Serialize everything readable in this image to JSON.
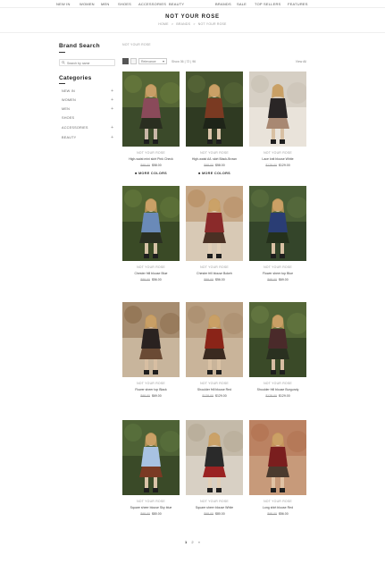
{
  "topnav": {
    "items": [
      "NEW IN",
      "WOMEN",
      "MEN",
      "SHOES",
      "ACCESSORIES",
      "BEAUTY",
      "BRANDS",
      "SALE",
      "TOP SELLERS",
      "FEATURES"
    ]
  },
  "header": {
    "title": "NOT YOUR ROSE",
    "breadcrumb": [
      "HOME",
      "BRANDS",
      "NOT YOUR ROSE"
    ],
    "breadcrumb_sep": ">"
  },
  "sidebar": {
    "brand_search_heading": "Brand Search",
    "search_placeholder": "Search by name",
    "search_icon": "search-icon",
    "categories_heading": "Categories",
    "categories": [
      {
        "label": "NEW IN"
      },
      {
        "label": "WOMEN"
      },
      {
        "label": "MEN"
      },
      {
        "label": "SHOES"
      },
      {
        "label": "ACCESSORIES"
      },
      {
        "label": "BEAUTY"
      }
    ],
    "expand_symbol": "+"
  },
  "main": {
    "breadcrumb": "NOT YOUR ROSE",
    "toolbar": {
      "sort_value": "Relevance",
      "show_label": "Show 36 | 72 | 96",
      "view_all": "View All",
      "grid_icon": "grid-view-icon",
      "list_icon": "list-view-icon"
    },
    "products": [
      {
        "brand": "NOT YOUR ROSE",
        "name": "High-waist mini skirt Pink Check",
        "old_price": "$98.00",
        "price": "$58.00",
        "more_colors": "MORE COLORS",
        "palette": [
          "#3b4a2a",
          "#6b7d3e",
          "#c9b7a7",
          "#8a4a5a",
          "#2a2e20"
        ]
      },
      {
        "brand": "NOT YOUR ROSE",
        "name": "High-waist A/L skirt Black-Brown",
        "old_price": "$98.00",
        "price": "$58.00",
        "more_colors": "MORE COLORS",
        "palette": [
          "#2f3a22",
          "#5b6b3a",
          "#d9c3a8",
          "#7a3a22",
          "#1e2418"
        ]
      },
      {
        "brand": "NOT YOUR ROSE",
        "name": "Lace knit blouse White",
        "old_price": "$128.00",
        "price": "$129.00",
        "more_colors": "",
        "palette": [
          "#e9e3da",
          "#c7bfb2",
          "#d8c0a3",
          "#2a2626",
          "#a88872"
        ]
      },
      {
        "brand": "NOT YOUR ROSE",
        "name": "Chester frill blouse Blue",
        "old_price": "$88.00",
        "price": "$56.00",
        "more_colors": "",
        "palette": [
          "#3a4a26",
          "#657a3c",
          "#d6c2a6",
          "#6a8ab8",
          "#2a2f22"
        ]
      },
      {
        "brand": "NOT YOUR ROSE",
        "name": "Chester frill blouse Bokeh",
        "old_price": "$88.00",
        "price": "$56.00",
        "more_colors": "",
        "palette": [
          "#d8c9b5",
          "#b68a5e",
          "#e1cfb7",
          "#8a2a2a",
          "#4a3024"
        ]
      },
      {
        "brand": "NOT YOUR ROSE",
        "name": "Flower sheer top Blue",
        "old_price": "$98.00",
        "price": "$69.00",
        "more_colors": "",
        "palette": [
          "#34452a",
          "#5d7240",
          "#d9c1a4",
          "#2a3d74",
          "#24301c"
        ]
      },
      {
        "brand": "NOT YOUR ROSE",
        "name": "Flower sheer top Black",
        "old_price": "$98.00",
        "price": "$69.00",
        "more_colors": "",
        "palette": [
          "#c8b59c",
          "#8a6a4a",
          "#d7bea2",
          "#2a2220",
          "#6a4a34"
        ]
      },
      {
        "brand": "NOT YOUR ROSE",
        "name": "Shoulder frill blouse Red",
        "old_price": "$128.00",
        "price": "$129.00",
        "more_colors": "",
        "palette": [
          "#c9b49a",
          "#a88a6a",
          "#d9c1a4",
          "#8a2418",
          "#3a2a20"
        ]
      },
      {
        "brand": "NOT YOUR ROSE",
        "name": "Shoulder frill blouse Burgundy",
        "old_price": "$128.00",
        "price": "$129.00",
        "more_colors": "",
        "palette": [
          "#3a4a28",
          "#6a7d44",
          "#d7bea2",
          "#4a2a2a",
          "#2a3020"
        ]
      },
      {
        "brand": "NOT YOUR ROSE",
        "name": "Square sheer blouse Sky blue",
        "old_price": "$98.00",
        "price": "$80.00",
        "more_colors": "",
        "palette": [
          "#3a4a28",
          "#5e7640",
          "#d9c3a8",
          "#a8c2e2",
          "#7a3a24"
        ]
      },
      {
        "brand": "NOT YOUR ROSE",
        "name": "Square sheer blouse White",
        "old_price": "$98.00",
        "price": "$80.00",
        "more_colors": "",
        "palette": [
          "#d8d0c4",
          "#b4a894",
          "#e2cfb6",
          "#2a2a2a",
          "#9a2222"
        ]
      },
      {
        "brand": "NOT YOUR ROSE",
        "name": "Long shirt blouse Red",
        "old_price": "$98.00",
        "price": "$56.00",
        "more_colors": "",
        "palette": [
          "#c79a7a",
          "#b0704e",
          "#e0c2a4",
          "#7a1e1e",
          "#4a3a2e"
        ]
      }
    ]
  },
  "pagination": {
    "pages": [
      "1",
      "2"
    ],
    "current": "1",
    "next": "»"
  }
}
